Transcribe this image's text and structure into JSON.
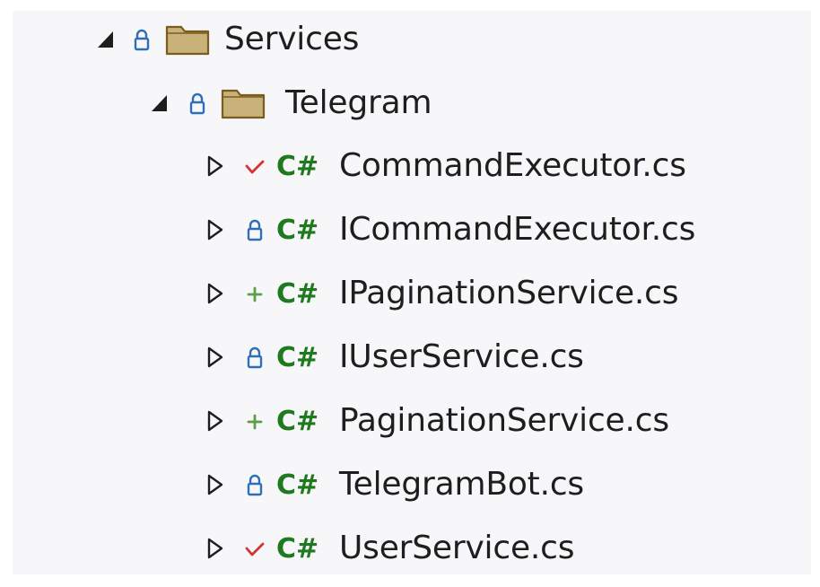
{
  "tree": {
    "folders": [
      {
        "label": "Services",
        "expanded": true,
        "status": "lock-icon"
      },
      {
        "label": "Telegram",
        "expanded": true,
        "status": "lock-icon"
      }
    ],
    "files": [
      {
        "label": "CommandExecutor.cs",
        "status": "checkmark-icon",
        "type_badge": "C#"
      },
      {
        "label": "ICommandExecutor.cs",
        "status": "lock-icon",
        "type_badge": "C#"
      },
      {
        "label": "IPaginationService.cs",
        "status": "plus-icon",
        "type_badge": "C#"
      },
      {
        "label": "IUserService.cs",
        "status": "lock-icon",
        "type_badge": "C#"
      },
      {
        "label": "PaginationService.cs",
        "status": "plus-icon",
        "type_badge": "C#"
      },
      {
        "label": "TelegramBot.cs",
        "status": "lock-icon",
        "type_badge": "C#"
      },
      {
        "label": "UserService.cs",
        "status": "checkmark-icon",
        "type_badge": "C#"
      }
    ]
  },
  "colors": {
    "lock": "#2f6fb8",
    "checkmark": "#d13438",
    "plus": "#5c9e4a",
    "csharp": "#1f7a1f",
    "folder_fill": "#c8b27a",
    "folder_stroke": "#7a5c1c",
    "text": "#1e1e1e"
  }
}
